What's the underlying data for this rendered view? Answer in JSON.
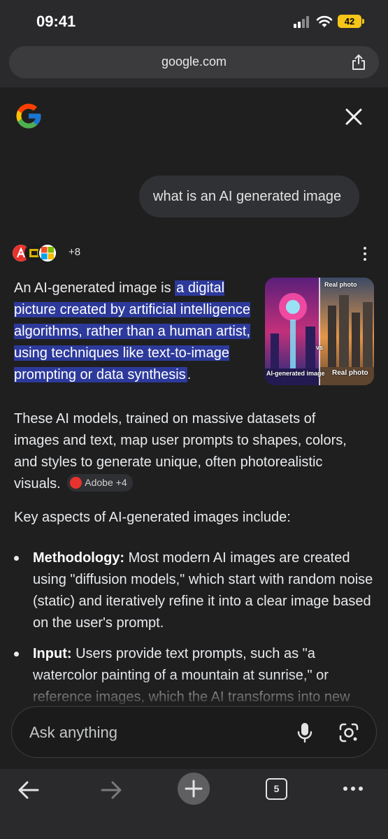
{
  "status_bar": {
    "time": "09:41",
    "battery": "42"
  },
  "browser": {
    "url": "google.com"
  },
  "ai_mode": {
    "query": "what is an AI generated image",
    "sources_more": "+8",
    "answer": {
      "lead": "An AI-generated image is ",
      "highlight": "a digital picture created by artificial intelligence algorithms, rather than a human artist, using techniques like text-to-image prompting or data synthesis",
      "end": ".",
      "continuation": "These AI models, trained on massive datasets of images and text, map user prompts to shapes, colors, and styles to generate unique, often photorealistic visuals.",
      "citation_chip": "Adobe +4"
    },
    "thumbnail": {
      "label_left": "AI-generated image",
      "label_vs": "vs",
      "label_top_right": "Real photo",
      "label_bottom_right": "Real photo"
    },
    "key_aspects_intro": "Key aspects of AI-generated images include:",
    "bullets": [
      {
        "title": "Methodology:",
        "text": " Most modern AI images are created using \"diffusion models,\" which start with random noise (static) and iteratively refine it into a clear image based on the user's prompt."
      },
      {
        "title": "Input:",
        "text": " Users provide text prompts, such as \"a watercolor painting of a mountain at sunrise,\" or reference images, which the AI transforms into new"
      }
    ],
    "ask_placeholder": "Ask anything"
  },
  "toolbar": {
    "tab_count": "5"
  },
  "colors": {
    "background": "#1f1f1f",
    "highlight": "#2d3a9b",
    "battery": "#f5c518"
  }
}
